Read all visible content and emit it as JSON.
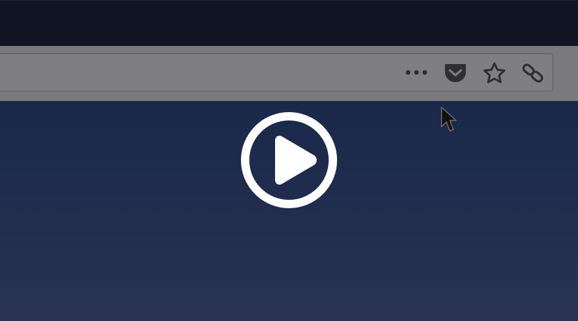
{
  "window": {
    "title_bar": "",
    "url": ""
  },
  "toolbar": {
    "icons": [
      "page-actions-menu-icon",
      "pocket-icon",
      "bookmark-star-icon",
      "link-icon"
    ]
  },
  "video": {
    "play_icon": "play-button-icon",
    "state": "paused"
  },
  "colors": {
    "title_strip": "#111422",
    "toolbar": "#7a7a7c",
    "content_top": "#162445",
    "content_bottom": "#2a3352",
    "play_icon": "#ffffff"
  }
}
